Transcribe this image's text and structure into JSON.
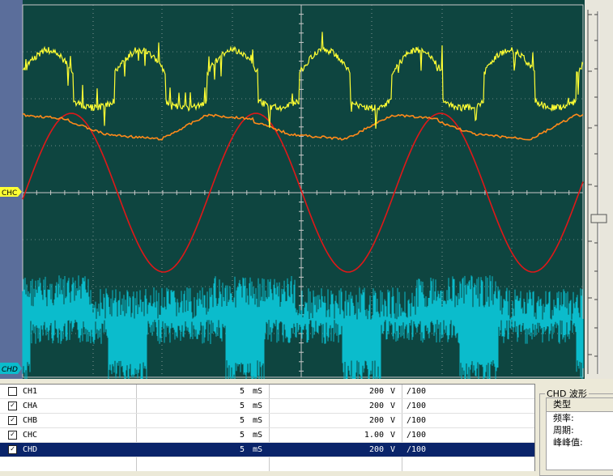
{
  "scope": {
    "background": "#0e4540",
    "grid_color": "#c8c8c8",
    "markers": {
      "chc": "CHC",
      "chd": "CHD"
    },
    "traces": [
      {
        "name": "CH1",
        "color": "#ffff33",
        "visible": true
      },
      {
        "name": "CHB",
        "color": "#ff8a1a",
        "visible": true
      },
      {
        "name": "CHC",
        "color": "#e01818",
        "visible": true
      },
      {
        "name": "CHD",
        "color": "#0bbccc",
        "visible": true
      }
    ]
  },
  "channels": [
    {
      "name": "CH1",
      "checked": false,
      "time_value": "5",
      "time_unit": "mS",
      "volt_value": "200",
      "volt_unit": "V",
      "probe": "/100",
      "selected": false
    },
    {
      "name": "CHA",
      "checked": true,
      "time_value": "5",
      "time_unit": "mS",
      "volt_value": "200",
      "volt_unit": "V",
      "probe": "/100",
      "selected": false
    },
    {
      "name": "CHB",
      "checked": true,
      "time_value": "5",
      "time_unit": "mS",
      "volt_value": "200",
      "volt_unit": "V",
      "probe": "/100",
      "selected": false
    },
    {
      "name": "CHC",
      "checked": true,
      "time_value": "5",
      "time_unit": "mS",
      "volt_value": "1.00",
      "volt_unit": "V",
      "probe": "/100",
      "selected": false
    },
    {
      "name": "CHD",
      "checked": true,
      "time_value": "5",
      "time_unit": "mS",
      "volt_value": "200",
      "volt_unit": "V",
      "probe": "/100",
      "selected": true
    }
  ],
  "info_panel": {
    "title": "CHD 波形",
    "header": "类型",
    "rows": [
      "频率:",
      "周期:",
      "峰峰值:"
    ]
  }
}
